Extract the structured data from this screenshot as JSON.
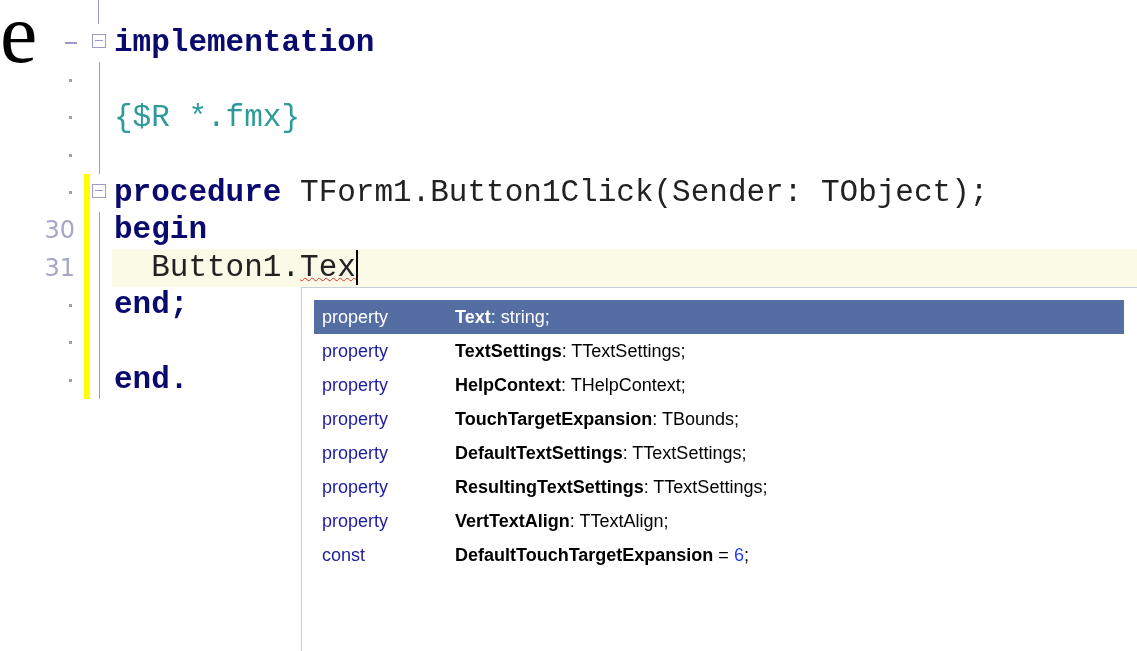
{
  "edge_fragment": "e",
  "editor": {
    "lines": [
      {
        "gutter": {
          "kind": "dash"
        },
        "fold_toggle": true,
        "modified": false,
        "current": false,
        "tokens": [
          {
            "kind": "keyword",
            "text": "implementation"
          }
        ]
      },
      {
        "gutter": {
          "kind": "dot"
        },
        "fold_toggle": false,
        "modified": false,
        "current": false
      },
      {
        "gutter": {
          "kind": "dot"
        },
        "fold_toggle": false,
        "modified": false,
        "current": false,
        "tokens": [
          {
            "kind": "comment",
            "text": "{$R *.fmx}"
          }
        ]
      },
      {
        "gutter": {
          "kind": "dot"
        },
        "fold_toggle": false,
        "modified": false,
        "current": false
      },
      {
        "gutter": {
          "kind": "dot"
        },
        "fold_toggle": true,
        "modified": true,
        "current": false,
        "tokens": [
          {
            "kind": "keyword",
            "text": "procedure"
          },
          {
            "kind": "plain",
            "text": " TForm1.Button1Click(Sender: TObject);"
          }
        ]
      },
      {
        "gutter": {
          "kind": "number",
          "text": "30"
        },
        "fold_toggle": false,
        "modified": true,
        "current": false,
        "tokens": [
          {
            "kind": "keyword",
            "text": "begin"
          }
        ]
      },
      {
        "gutter": {
          "kind": "number",
          "text": "31"
        },
        "fold_toggle": false,
        "modified": true,
        "current": true,
        "tokens": [
          {
            "kind": "plain",
            "text": "  Button1."
          },
          {
            "kind": "error",
            "text": "Tex",
            "caret": true
          }
        ]
      },
      {
        "gutter": {
          "kind": "dot"
        },
        "fold_toggle": false,
        "modified": true,
        "current": false,
        "tokens": [
          {
            "kind": "keyword",
            "text": "end;"
          }
        ]
      },
      {
        "gutter": {
          "kind": "dot"
        },
        "fold_toggle": false,
        "modified": true,
        "current": false
      },
      {
        "gutter": {
          "kind": "dot"
        },
        "fold_toggle": false,
        "modified": true,
        "current": false,
        "tokens": [
          {
            "kind": "keyword",
            "text": "end."
          }
        ]
      }
    ]
  },
  "completion": {
    "items": [
      {
        "kind": "property",
        "name": "Text",
        "selected": true,
        "detail": [
          {
            "kind": "plain",
            "text": ": string;"
          }
        ]
      },
      {
        "kind": "property",
        "name": "TextSettings",
        "selected": false,
        "detail": [
          {
            "kind": "plain",
            "text": ": TTextSettings;"
          }
        ]
      },
      {
        "kind": "property",
        "name": "HelpContext",
        "selected": false,
        "detail": [
          {
            "kind": "plain",
            "text": ": THelpContext;"
          }
        ]
      },
      {
        "kind": "property",
        "name": "TouchTargetExpansion",
        "selected": false,
        "detail": [
          {
            "kind": "plain",
            "text": ": TBounds;"
          }
        ]
      },
      {
        "kind": "property",
        "name": "DefaultTextSettings",
        "selected": false,
        "detail": [
          {
            "kind": "plain",
            "text": ": TTextSettings;"
          }
        ]
      },
      {
        "kind": "property",
        "name": "ResultingTextSettings",
        "selected": false,
        "detail": [
          {
            "kind": "plain",
            "text": ": TTextSettings;"
          }
        ]
      },
      {
        "kind": "property",
        "name": "VertTextAlign",
        "selected": false,
        "detail": [
          {
            "kind": "plain",
            "text": ": TTextAlign;"
          }
        ]
      },
      {
        "kind": "const",
        "name": "DefaultTouchTargetExpansion",
        "selected": false,
        "detail": [
          {
            "kind": "plain",
            "text": " = "
          },
          {
            "kind": "number",
            "text": "6"
          },
          {
            "kind": "plain",
            "text": ";"
          }
        ]
      }
    ]
  }
}
